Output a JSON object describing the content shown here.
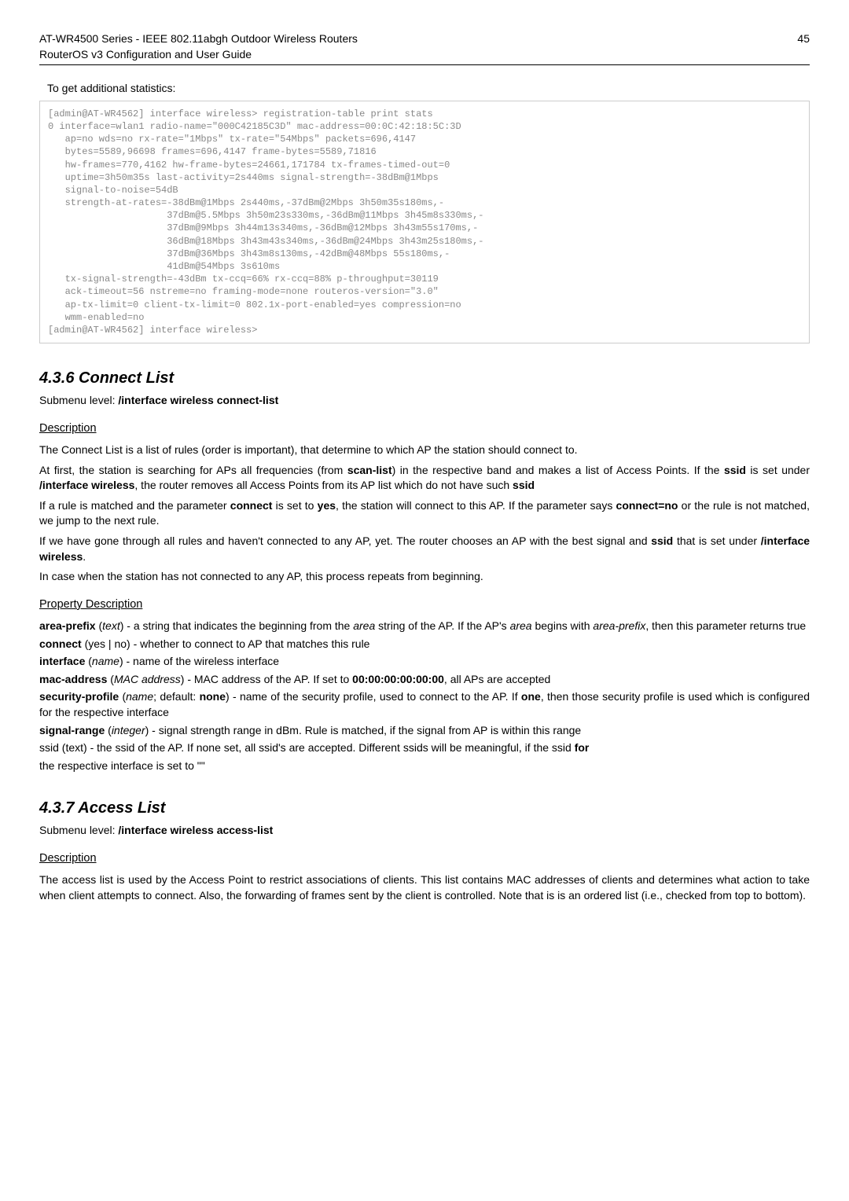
{
  "header": {
    "line1": "AT-WR4500 Series - IEEE 802.11abgh Outdoor Wireless Routers",
    "line2": "RouterOS v3 Configuration and User Guide",
    "page": "45"
  },
  "statsIntro": "To get additional statistics:",
  "codeBlock": "[admin@AT-WR4562] interface wireless> registration-table print stats\n0 interface=wlan1 radio-name=\"000C42185C3D\" mac-address=00:0C:42:18:5C:3D\n   ap=no wds=no rx-rate=\"1Mbps\" tx-rate=\"54Mbps\" packets=696,4147\n   bytes=5589,96698 frames=696,4147 frame-bytes=5589,71816\n   hw-frames=770,4162 hw-frame-bytes=24661,171784 tx-frames-timed-out=0\n   uptime=3h50m35s last-activity=2s440ms signal-strength=-38dBm@1Mbps\n   signal-to-noise=54dB\n   strength-at-rates=-38dBm@1Mbps 2s440ms,-37dBm@2Mbps 3h50m35s180ms,-\n                     37dBm@5.5Mbps 3h50m23s330ms,-36dBm@11Mbps 3h45m8s330ms,-\n                     37dBm@9Mbps 3h44m13s340ms,-36dBm@12Mbps 3h43m55s170ms,-\n                     36dBm@18Mbps 3h43m43s340ms,-36dBm@24Mbps 3h43m25s180ms,-\n                     37dBm@36Mbps 3h43m8s130ms,-42dBm@48Mbps 55s180ms,-\n                     41dBm@54Mbps 3s610ms\n   tx-signal-strength=-43dBm tx-ccq=66% rx-ccq=88% p-throughput=30119\n   ack-timeout=56 nstreme=no framing-mode=none routeros-version=\"3.0\"\n   ap-tx-limit=0 client-tx-limit=0 802.1x-port-enabled=yes compression=no\n   wmm-enabled=no\n[admin@AT-WR4562] interface wireless>",
  "section436": {
    "title": "4.3.6 Connect List",
    "submenuPrefix": "Submenu level: ",
    "submenuBold": "/interface wireless connect-list",
    "descHeading": "Description",
    "desc": {
      "p1": "The Connect List is a list of rules (order is important), that determine to which AP the station should connect to.",
      "p2a": "At first, the station is searching for APs all frequencies (from ",
      "p2b": "scan-list",
      "p2c": ") in the respective band and makes a list of Access Points. If the ",
      "p2d": "ssid",
      "p2e": " is set under ",
      "p2f": "/interface wireless",
      "p2g": ", the router removes all Access Points from its AP list which do not have such ",
      "p2h": "ssid",
      "p3a": "If a rule is matched and the parameter ",
      "p3b": "connect",
      "p3c": " is set to ",
      "p3d": "yes",
      "p3e": ", the station will connect to this AP. If the parameter says ",
      "p3f": "connect=no",
      "p3g": " or the rule is not matched, we jump to the next rule.",
      "p4a": "If we have gone through all rules and haven't connected to any AP, yet. The router chooses an AP with the best signal and ",
      "p4b": "ssid",
      "p4c": " that is set under ",
      "p4d": "/interface wireless",
      "p4e": ".",
      "p5": "In case when the station has not connected to any AP, this process repeats from beginning."
    },
    "propHeading": "Property Description",
    "prop": {
      "areaPrefix1": "area-prefix",
      "areaPrefix2": " (",
      "areaPrefix3": "text",
      "areaPrefix4": ") - a string that indicates the beginning from the ",
      "areaPrefix5": "area",
      "areaPrefix6": " string of the AP. If the AP's ",
      "areaPrefix7": "area",
      "areaPrefix8": " begins with ",
      "areaPrefix9": "area-prefix",
      "areaPrefix10": ", then this parameter returns true",
      "connect1": "connect",
      "connect2": " (yes | no) - whether to connect to AP that matches this rule",
      "interface1": "interface",
      "interface2": " (",
      "interface3": "name",
      "interface4": ") - name of the wireless interface",
      "mac1": "mac-address",
      "mac2": " (",
      "mac3": "MAC address",
      "mac4": ") - MAC address of the AP. If set to ",
      "mac5": "00:00:00:00:00:00",
      "mac6": ", all APs are accepted",
      "sec1": "security-profile",
      "sec2": " (",
      "sec3": "name",
      "sec4": "; default: ",
      "sec5": "none",
      "sec6": ") - name of the security profile, used to connect to the AP. If ",
      "sec7": "one",
      "sec8": ", then those security profile is used which is configured for the respective interface",
      "sig1": "signal-range",
      "sig2": " (",
      "sig3": "integer",
      "sig4": ") - signal strength range in dBm. Rule is matched, if the signal from AP is within this range",
      "ssid1": "ssid (text) - the ssid of the AP. If none set, all ssid's are accepted. Different ssids will be meaningful, if the ssid ",
      "ssid2": "for",
      "resp": "the respective interface is set to \"\""
    }
  },
  "section437": {
    "title": "4.3.7 Access List",
    "submenuPrefix": "Submenu level: ",
    "submenuBold": "/interface wireless access-list",
    "descHeading": "Description",
    "desc": "The access list is used by the Access Point to restrict associations of clients. This list contains MAC addresses of clients and determines what action to take when client attempts to connect. Also, the forwarding of frames sent by the client is controlled. Note that is is an ordered list (i.e., checked from top to bottom)."
  }
}
